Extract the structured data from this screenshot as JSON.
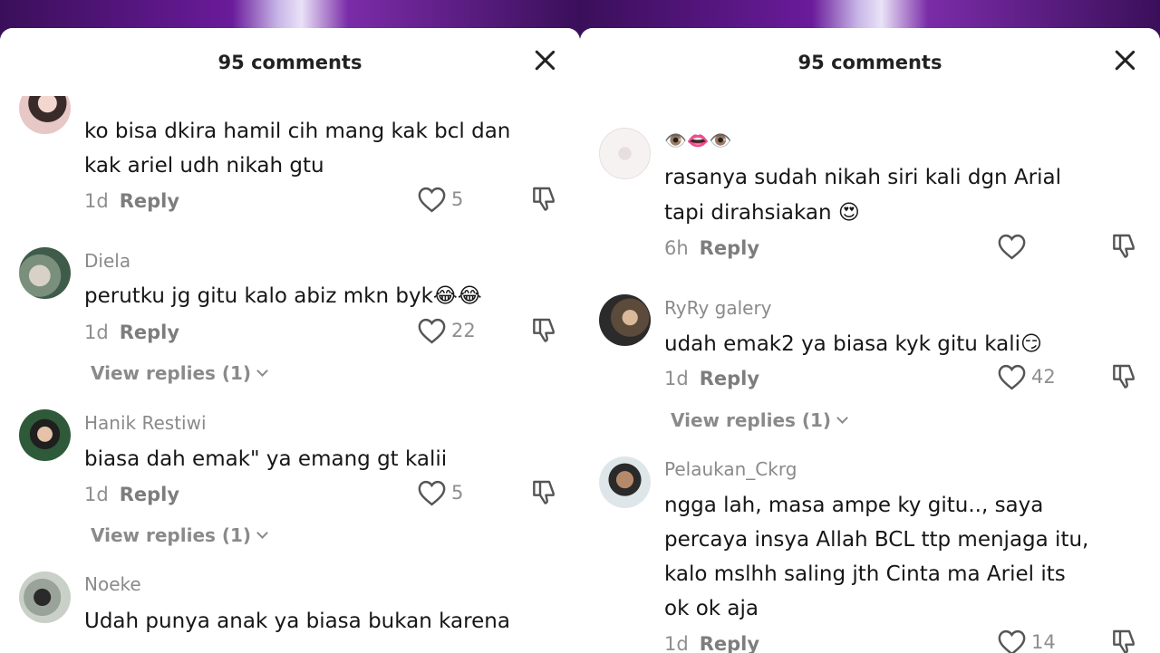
{
  "left_panel": {
    "title": "95 comments",
    "comments": [
      {
        "username": "",
        "lines": [
          "ko bisa dkira hamil cih mang kak bcl dan",
          "kak ariel udh nikah gtu"
        ],
        "age": "1d",
        "reply_label": "Reply",
        "likes": "5"
      },
      {
        "username": "Diela",
        "lines": [
          "perutku jg gitu kalo abiz mkn byk😂😂"
        ],
        "age": "1d",
        "reply_label": "Reply",
        "likes": "22",
        "view_replies": "View replies (1)"
      },
      {
        "username": "Hanik Restiwi",
        "lines": [
          "biasa dah emak\" ya emang gt kalii"
        ],
        "age": "1d",
        "reply_label": "Reply",
        "likes": "5",
        "view_replies": "View replies (1)"
      },
      {
        "username": "Noeke",
        "lines": [
          "Udah punya anak ya biasa bukan karena"
        ]
      }
    ]
  },
  "right_panel": {
    "title": "95 comments",
    "comments": [
      {
        "username": "👁️👄👁️",
        "lines": [
          "rasanya sudah nikah siri kali dgn Arial",
          "tapi dirahsiakan 😍"
        ],
        "age": "6h",
        "reply_label": "Reply",
        "likes": ""
      },
      {
        "username": "RyRy galery",
        "lines": [
          "udah emak2 ya biasa kyk gitu kali😏"
        ],
        "age": "1d",
        "reply_label": "Reply",
        "likes": "42",
        "view_replies": "View replies (1)"
      },
      {
        "username": "Pelaukan_Ckrg",
        "lines": [
          "ngga lah, masa ampe ky gitu.., saya",
          "percaya insya Allah BCL ttp menjaga itu,",
          "kalo mslhh saling jth Cinta ma Ariel its",
          "ok ok aja"
        ],
        "age": "1d",
        "reply_label": "Reply",
        "likes": "14"
      }
    ]
  },
  "icons": {
    "close": "close-icon",
    "like": "heart-outline-icon",
    "dislike": "thumbs-down-icon",
    "chevron": "chevron-down-icon"
  },
  "colors": {
    "text": "#161616",
    "muted": "#8a8a8a",
    "panel": "#ffffff",
    "backdrop": "#6a1b9a"
  }
}
